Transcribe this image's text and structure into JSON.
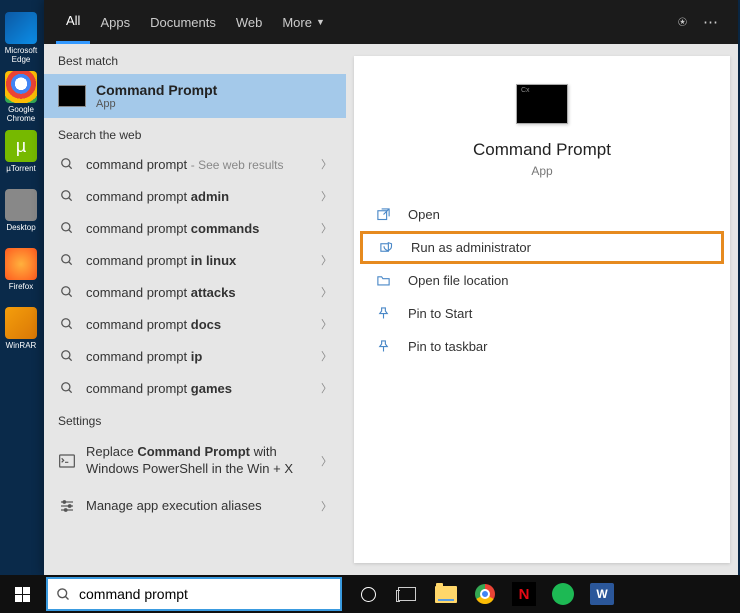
{
  "desktop": {
    "icons": [
      {
        "label": "Microsoft Edge"
      },
      {
        "label": "Google Chrome"
      },
      {
        "label": "µTorrent"
      },
      {
        "label": "Desktop"
      },
      {
        "label": "Firefox"
      },
      {
        "label": "WinRAR"
      }
    ]
  },
  "tabs": {
    "items": [
      {
        "label": "All"
      },
      {
        "label": "Apps"
      },
      {
        "label": "Documents"
      },
      {
        "label": "Web"
      },
      {
        "label": "More"
      }
    ]
  },
  "best_match_label": "Best match",
  "best_match": {
    "title": "Command Prompt",
    "sub": "App"
  },
  "search_web_label": "Search the web",
  "web_results": {
    "base": "command prompt",
    "hint": "See web results",
    "suffixes": [
      "admin",
      "commands",
      "in linux",
      "attacks",
      "docs",
      "ip",
      "games"
    ]
  },
  "settings_label": "Settings",
  "settings": [
    {
      "line1_a": "Replace ",
      "line1_b": "Command Prompt",
      "line1_c": " with",
      "line2": "Windows PowerShell in the Win + X"
    },
    {
      "text": "Manage app execution aliases"
    }
  ],
  "preview": {
    "title": "Command Prompt",
    "sub": "App"
  },
  "actions": [
    {
      "label": "Open"
    },
    {
      "label": "Run as administrator"
    },
    {
      "label": "Open file location"
    },
    {
      "label": "Pin to Start"
    },
    {
      "label": "Pin to taskbar"
    }
  ],
  "search_value": "command prompt"
}
